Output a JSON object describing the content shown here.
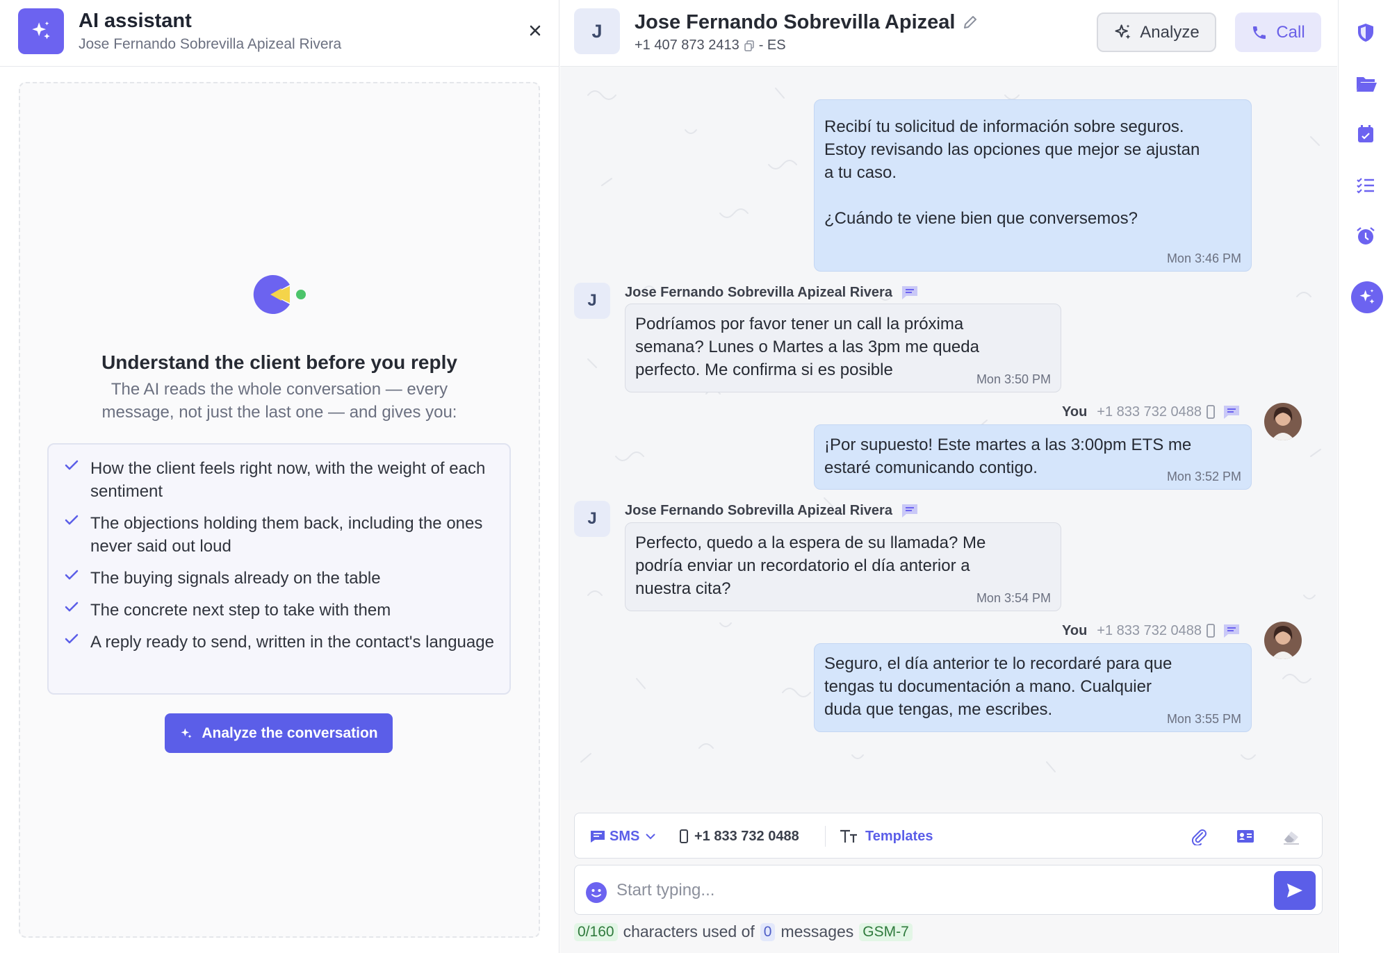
{
  "ai_panel": {
    "title": "AI assistant",
    "subtitle": "Jose Fernando Sobrevilla Apizeal Rivera",
    "close_icon": "close-icon",
    "heading": "Understand the client before you reply",
    "description": "The AI reads the whole conversation — every message, not just the last one — and gives you:",
    "features": [
      "How the client feels right now, with the weight of each sentiment",
      "The objections holding them back, including the ones never said out loud",
      "The buying signals already on the table",
      "The concrete next step to take with them",
      "A reply ready to send, written in the contact's language"
    ],
    "button_label": "Analyze the conversation",
    "accent_color": "#5b5ee8"
  },
  "header": {
    "avatar_initial": "J",
    "contact_name": "Jose Fernando Sobrevilla Apizeal",
    "phone": "+1 407 873 2413",
    "language": "- ES",
    "analyze_label": "Analyze",
    "call_label": "Call"
  },
  "messages": [
    {
      "direction": "outgoing",
      "text_lines": [
        "Recibí tu solicitud de información sobre seguros.",
        "Estoy revisando las opciones que mejor se ajustan",
        "a tu caso.",
        "",
        "¿Cuándo te viene bien que conversemos?"
      ],
      "time": "Mon 3:46 PM"
    },
    {
      "direction": "incoming",
      "sender": "Jose Fernando Sobrevilla Apizeal Rivera",
      "avatar_initial": "J",
      "text_lines": [
        "Podríamos por favor tener un call la próxima",
        "semana? Lunes o Martes a las 3pm me queda",
        "perfecto. Me confirma si es posible"
      ],
      "time": "Mon 3:50 PM"
    },
    {
      "direction": "outgoing",
      "sender": "You",
      "from_number": "+1 833 732 0488",
      "text_lines": [
        "¡Por supuesto! Este martes a las 3:00pm ETS me",
        "estaré comunicando contigo."
      ],
      "time": "Mon 3:52 PM"
    },
    {
      "direction": "incoming",
      "sender": "Jose Fernando Sobrevilla Apizeal Rivera",
      "avatar_initial": "J",
      "text_lines": [
        "Perfecto, quedo a la espera de su llamada? Me",
        "podría enviar un recordatorio el día anterior a",
        "nuestra cita?"
      ],
      "time": "Mon 3:54 PM"
    },
    {
      "direction": "outgoing",
      "sender": "You",
      "from_number": "+1 833 732 0488",
      "text_lines": [
        "Seguro, el día anterior te lo recordaré para que",
        "tengas tu documentación a mano. Cualquier",
        "duda que tengas, me escribes."
      ],
      "time": "Mon 3:55 PM"
    }
  ],
  "composer": {
    "channel": "SMS",
    "from_number": "+1 833 732 0488",
    "templates_label": "Templates",
    "placeholder": "Start typing...",
    "counter": "0/160",
    "counter_text_1": "characters used of",
    "messages_count": "0",
    "counter_text_2": "messages",
    "encoding": "GSM-7"
  },
  "rail": {
    "icons": [
      "shield-icon",
      "folder-icon",
      "calendar-icon",
      "checklist-icon",
      "alarm-icon",
      "ai-sparkle-icon"
    ]
  }
}
